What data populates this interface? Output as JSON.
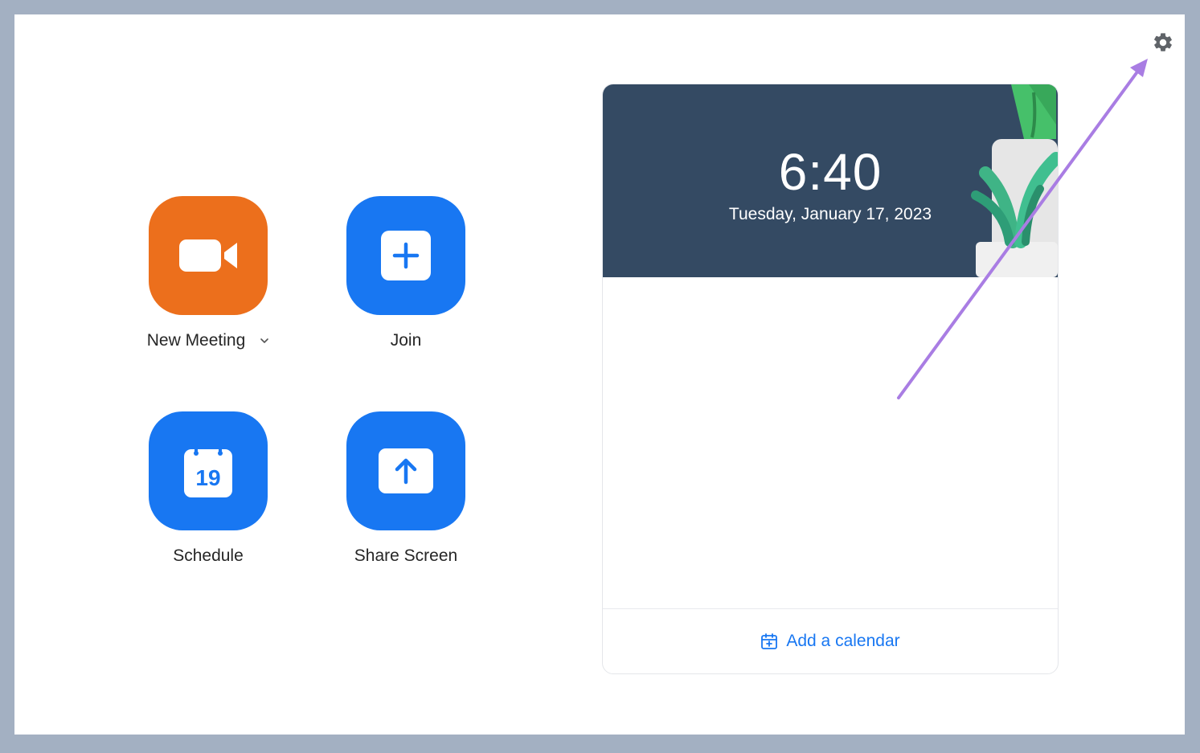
{
  "actions": {
    "new_meeting": "New Meeting",
    "join": "Join",
    "schedule": "Schedule",
    "schedule_day": "19",
    "share_screen": "Share Screen"
  },
  "calendar_card": {
    "time": "6:40",
    "date": "Tuesday, January 17, 2023",
    "add_calendar": "Add a calendar"
  },
  "icons": {
    "settings": "gear-icon",
    "new_meeting": "video-camera-icon",
    "join": "plus-icon",
    "schedule": "calendar-icon",
    "share_screen": "upload-arrow-icon",
    "dropdown": "chevron-down-icon",
    "add_calendar": "calendar-plus-icon"
  },
  "colors": {
    "new_meeting_button": "#ec6f1c",
    "action_button": "#1877f2",
    "banner": "#344a63",
    "annotation_arrow": "#a97de3"
  }
}
